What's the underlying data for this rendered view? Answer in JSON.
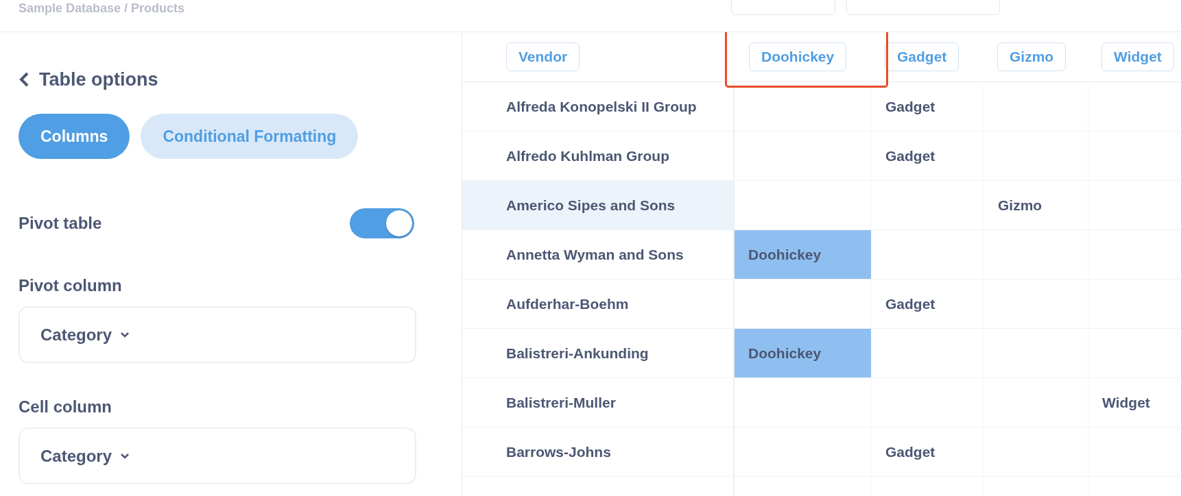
{
  "breadcrumb": "Sample Database / Products",
  "sidebar": {
    "back_title": "Table options",
    "tabs": [
      {
        "label": "Columns",
        "selected": true
      },
      {
        "label": "Conditional Formatting",
        "selected": false
      }
    ],
    "pivot_table": {
      "label": "Pivot table",
      "on": true
    },
    "pivot_column": {
      "label": "Pivot column",
      "value": "Category"
    },
    "cell_column": {
      "label": "Cell column",
      "value": "Category"
    }
  },
  "table": {
    "columns": [
      {
        "label": "Vendor",
        "outlined": false
      },
      {
        "label": "Doohickey",
        "outlined": true
      },
      {
        "label": "Gadget",
        "outlined": false
      },
      {
        "label": "Gizmo",
        "outlined": false
      },
      {
        "label": "Widget",
        "outlined": false
      }
    ],
    "rows": [
      {
        "hovered": false,
        "highlighted": false,
        "cells": [
          "Alfreda Konopelski II Group",
          "",
          "Gadget",
          "",
          ""
        ]
      },
      {
        "hovered": false,
        "highlighted": false,
        "cells": [
          "Alfredo Kuhlman Group",
          "",
          "Gadget",
          "",
          ""
        ]
      },
      {
        "hovered": true,
        "highlighted": false,
        "cells": [
          "Americo Sipes and Sons",
          "",
          "",
          "Gizmo",
          ""
        ]
      },
      {
        "hovered": false,
        "highlighted": true,
        "cells": [
          "Annetta Wyman and Sons",
          "Doohickey",
          "",
          "",
          ""
        ]
      },
      {
        "hovered": false,
        "highlighted": false,
        "cells": [
          "Aufderhar-Boehm",
          "",
          "Gadget",
          "",
          ""
        ]
      },
      {
        "hovered": false,
        "highlighted": true,
        "cells": [
          "Balistreri-Ankunding",
          "Doohickey",
          "",
          "",
          ""
        ]
      },
      {
        "hovered": false,
        "highlighted": false,
        "cells": [
          "Balistreri-Muller",
          "",
          "",
          "",
          "Widget"
        ]
      },
      {
        "hovered": false,
        "highlighted": false,
        "cells": [
          "Barrows-Johns",
          "",
          "Gadget",
          "",
          ""
        ]
      }
    ]
  }
}
